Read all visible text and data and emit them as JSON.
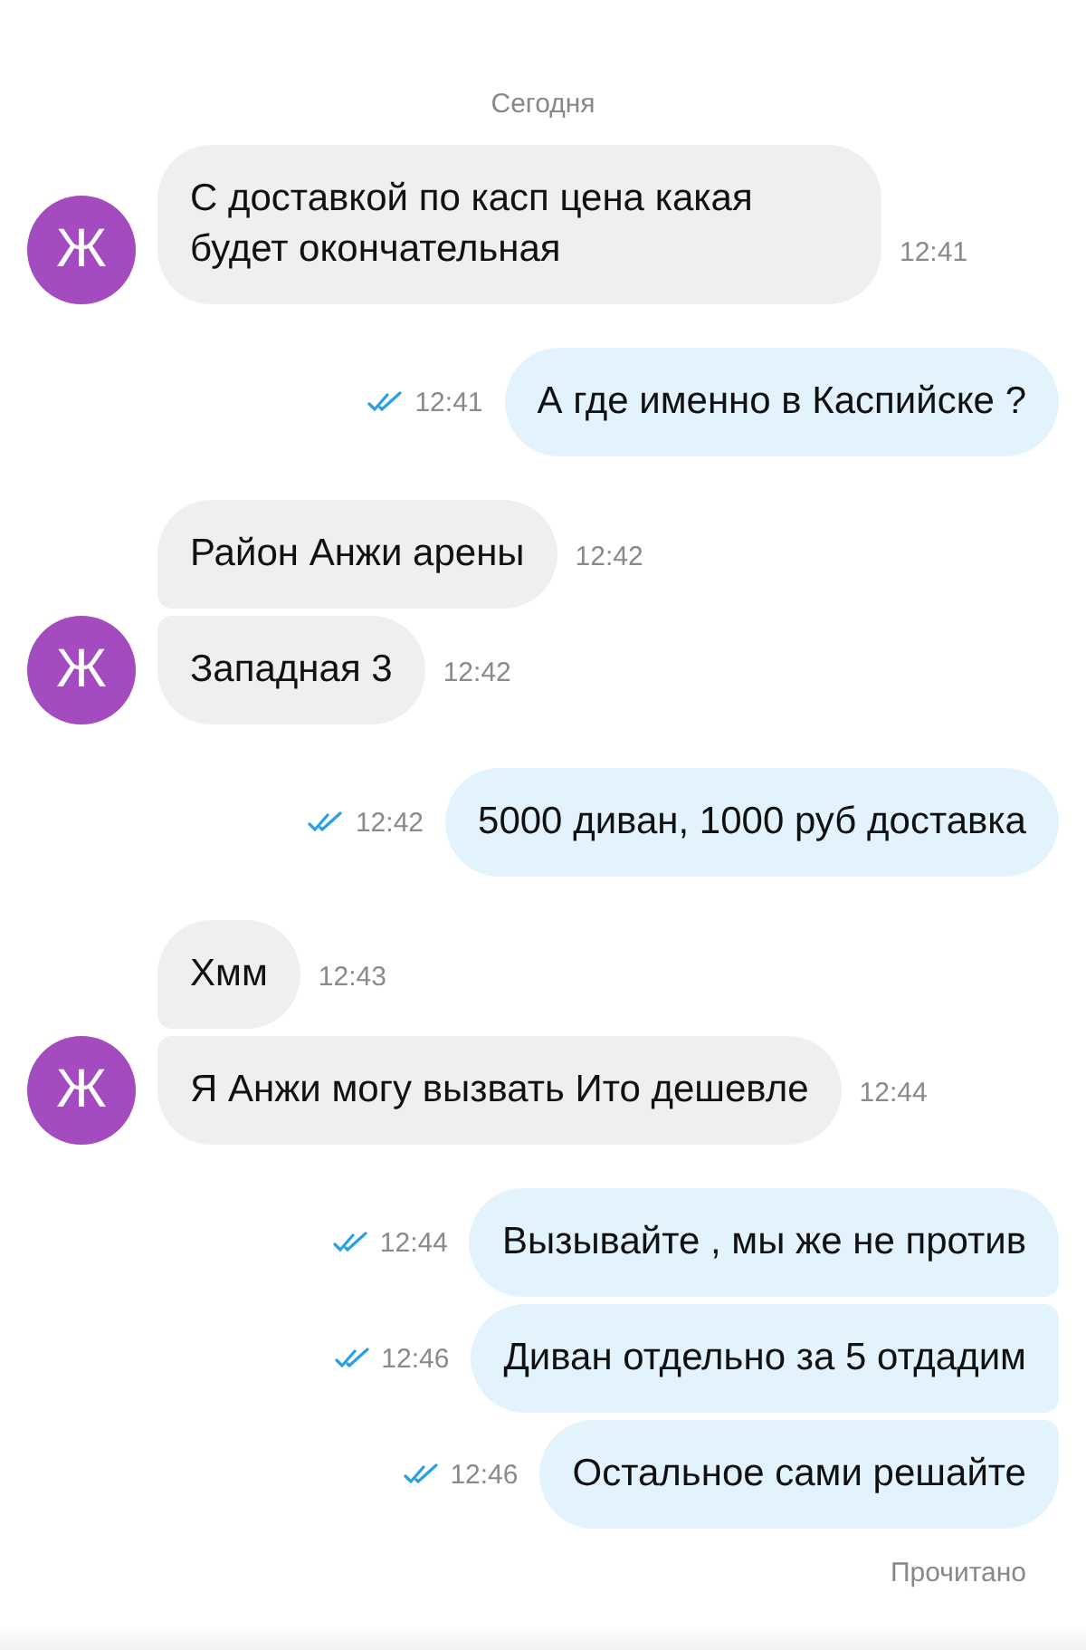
{
  "date_divider": "Сегодня",
  "groups": [
    {
      "kind": "incoming",
      "avatar": "Ж",
      "messages": [
        {
          "text": "С доставкой по касп цена какая будет окончательная",
          "time": "12:41"
        }
      ]
    },
    {
      "kind": "outgoing",
      "messages": [
        {
          "text": "А где именно в Каспийске ?",
          "time": "12:41",
          "read": true
        }
      ]
    },
    {
      "kind": "incoming",
      "avatar": "Ж",
      "messages": [
        {
          "text": "Район Анжи арены",
          "time": "12:42"
        },
        {
          "text": "Западная 3",
          "time": "12:42"
        }
      ]
    },
    {
      "kind": "outgoing",
      "messages": [
        {
          "text": "5000 диван, 1000 руб доставка",
          "time": "12:42",
          "read": true
        }
      ]
    },
    {
      "kind": "incoming",
      "avatar": "Ж",
      "messages": [
        {
          "text": "Хмм",
          "time": "12:43"
        },
        {
          "text": "Я Анжи могу вызвать Ито дешевле",
          "time": "12:44"
        }
      ]
    },
    {
      "kind": "outgoing",
      "messages": [
        {
          "text": "Вызывайте , мы же не против",
          "time": "12:44",
          "read": true
        },
        {
          "text": "Диван отдельно за 5 отдадим",
          "time": "12:46",
          "read": true
        },
        {
          "text": "Остальное сами решайте",
          "time": "12:46",
          "read": true
        }
      ]
    }
  ],
  "status": "Прочитано"
}
